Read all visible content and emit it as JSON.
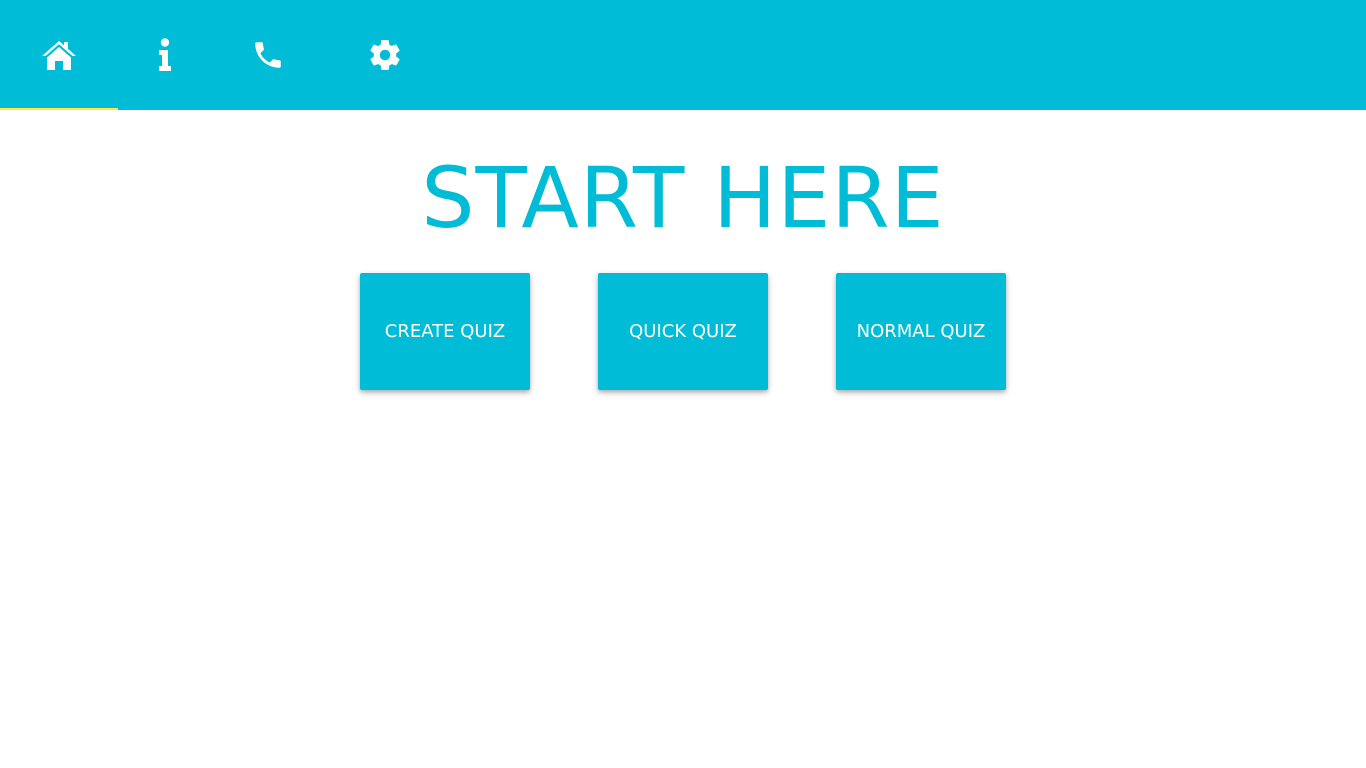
{
  "header": {
    "tabs": [
      {
        "id": "home",
        "icon": "home-icon",
        "active": true
      },
      {
        "id": "info",
        "icon": "info-icon",
        "active": false
      },
      {
        "id": "contact",
        "icon": "phone-icon",
        "active": false
      },
      {
        "id": "settings",
        "icon": "gear-icon",
        "active": false
      }
    ]
  },
  "main": {
    "title": "START HERE",
    "buttons": [
      {
        "label": "CREATE QUIZ"
      },
      {
        "label": "QUICK QUIZ"
      },
      {
        "label": "NORMAL QUIZ"
      }
    ]
  },
  "colors": {
    "accent": "#00bcd6",
    "active_indicator": "#ffeb3b",
    "background": "#ffffff",
    "icon": "#ffffff"
  }
}
